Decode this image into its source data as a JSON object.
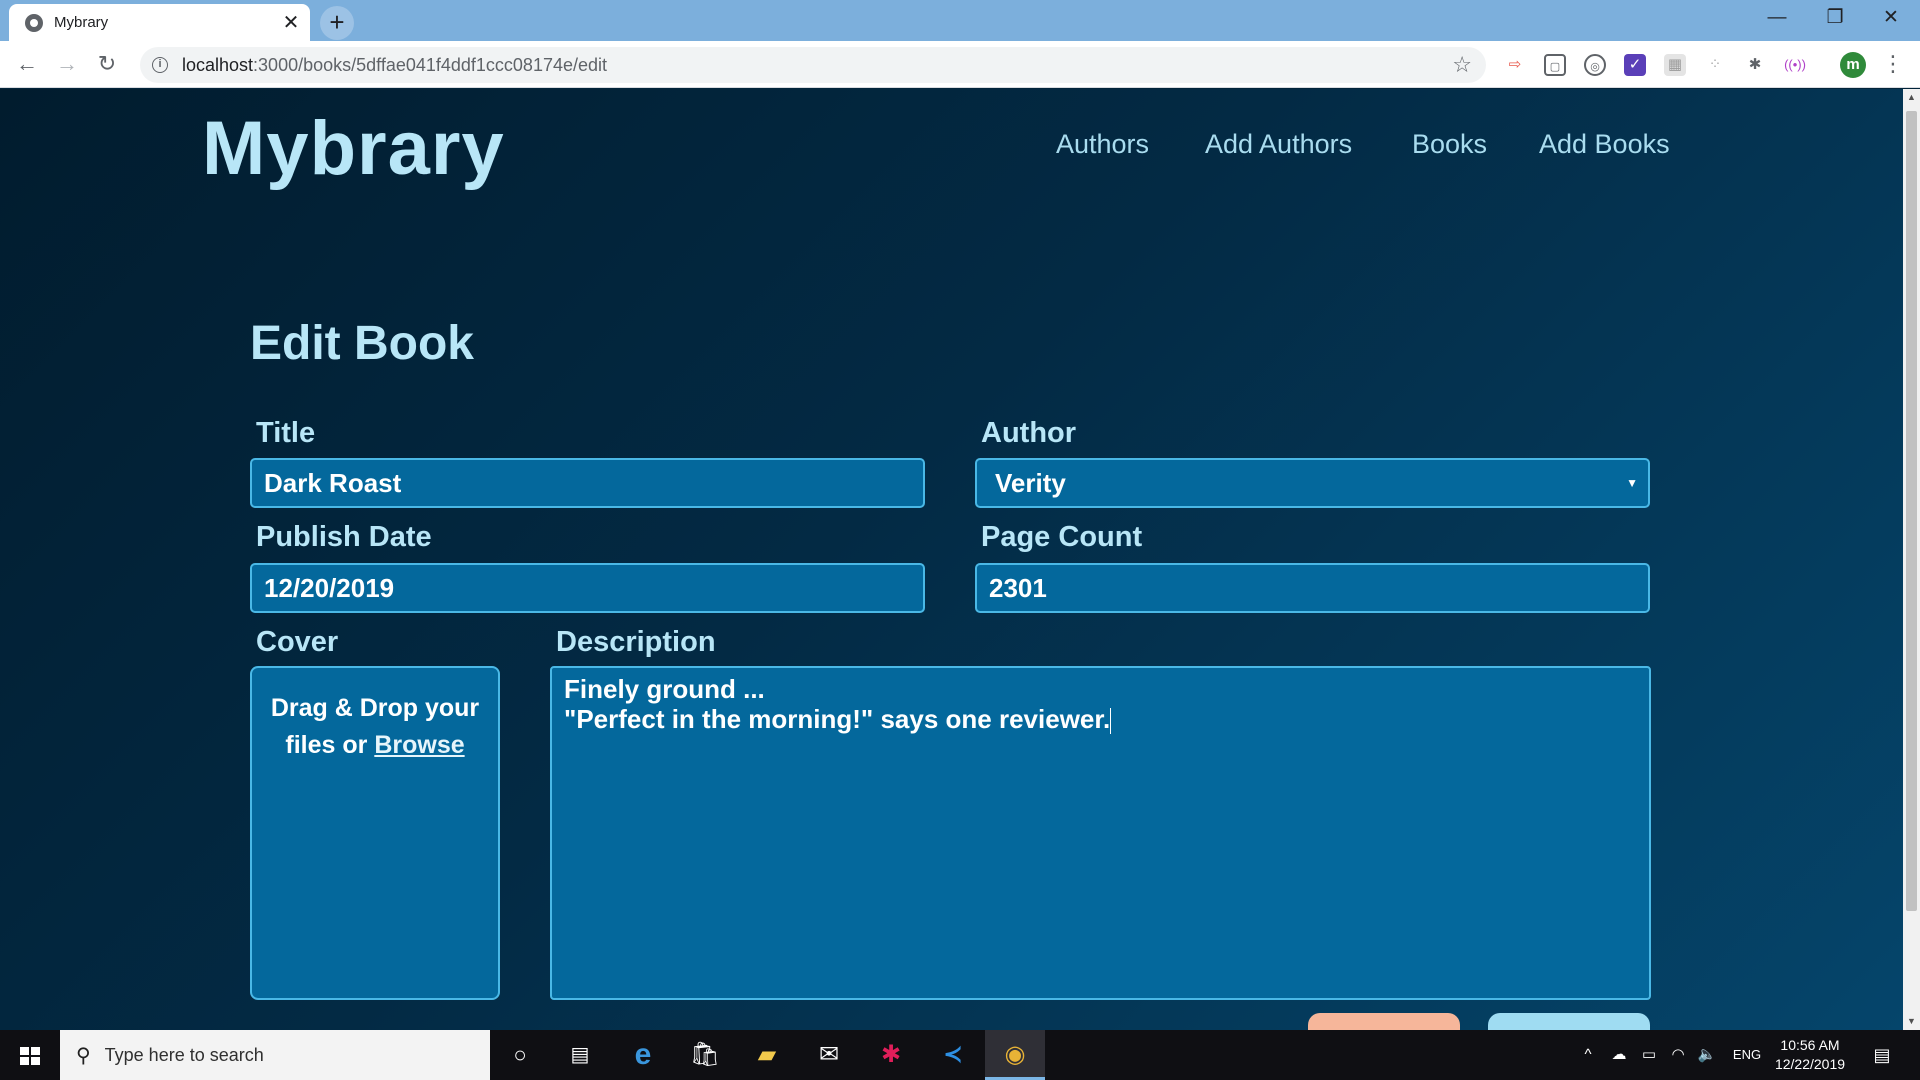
{
  "browser": {
    "tab_title": "Mybrary",
    "tab_close": "✕",
    "new_tab": "+",
    "url_host": "localhost",
    "url_rest": ":3000/books/5dffae041f4ddf1ccc08174e/edit",
    "profile_initial": "m",
    "window_controls": {
      "minimize": "—",
      "restore": "❐",
      "close": "✕"
    }
  },
  "site": {
    "logo": "Mybrary",
    "nav": {
      "authors": "Authors",
      "add_authors": "Add Authors",
      "books": "Books",
      "add_books": "Add Books"
    }
  },
  "form": {
    "heading": "Edit Book",
    "title_label": "Title",
    "title_value": "Dark Roast",
    "author_label": "Author",
    "author_value": "Verity",
    "publish_date_label": "Publish Date",
    "publish_date_value": "12/20/2019",
    "page_count_label": "Page Count",
    "page_count_value": "2301",
    "cover_label": "Cover",
    "cover_prompt": "Drag & Drop your files or",
    "cover_browse": "Browse",
    "description_label": "Description",
    "description_line1": "Finely ground ...",
    "description_line2": "\"Perfect in the morning!\" says one reviewer."
  },
  "colors": {
    "page_background": "#02243a",
    "field_background": "#04689c",
    "field_border": "#4ab8e6",
    "text_accent": "#b8e6f7",
    "cancel_button": "#f6b69a",
    "update_button": "#9fdcf2"
  },
  "taskbar": {
    "search_placeholder": "Type here to search",
    "language": "ENG",
    "time": "10:56 AM",
    "date": "12/22/2019"
  }
}
